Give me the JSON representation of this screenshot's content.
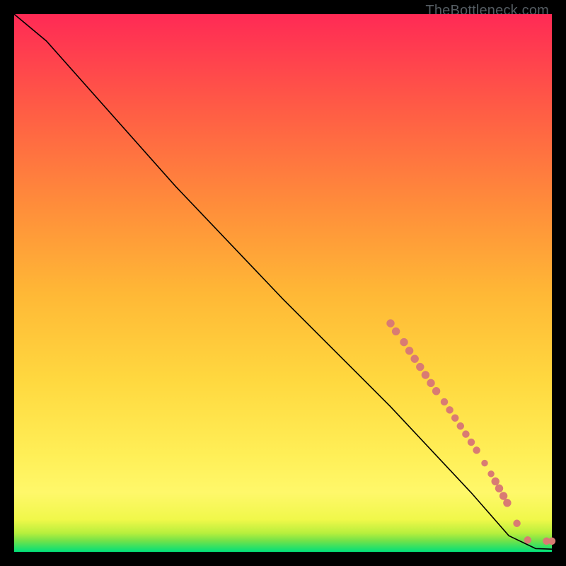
{
  "watermark": "TheBottleneck.com",
  "chart_data": {
    "type": "line",
    "title": "",
    "xlabel": "",
    "ylabel": "",
    "xlim": [
      0,
      100
    ],
    "ylim": [
      0,
      100
    ],
    "curve": {
      "name": "bottleneck-curve",
      "points": [
        {
          "x": 0,
          "y": 100
        },
        {
          "x": 6,
          "y": 95
        },
        {
          "x": 14,
          "y": 86
        },
        {
          "x": 30,
          "y": 68
        },
        {
          "x": 50,
          "y": 47
        },
        {
          "x": 70,
          "y": 27
        },
        {
          "x": 85,
          "y": 11
        },
        {
          "x": 92,
          "y": 3
        },
        {
          "x": 97,
          "y": 0.6
        },
        {
          "x": 100,
          "y": 0.5
        }
      ]
    },
    "scatter": {
      "name": "data-points",
      "color": "#d97b73",
      "points": [
        {
          "x": 70.0,
          "y": 42.5,
          "r": 5.5
        },
        {
          "x": 71.0,
          "y": 41.0,
          "r": 5.5
        },
        {
          "x": 72.5,
          "y": 39.0,
          "r": 5.5
        },
        {
          "x": 73.5,
          "y": 37.4,
          "r": 5.5
        },
        {
          "x": 74.5,
          "y": 35.9,
          "r": 5.5
        },
        {
          "x": 75.5,
          "y": 34.4,
          "r": 5.5
        },
        {
          "x": 76.5,
          "y": 32.9,
          "r": 5.5
        },
        {
          "x": 77.5,
          "y": 31.4,
          "r": 5.5
        },
        {
          "x": 78.5,
          "y": 29.9,
          "r": 5.5
        },
        {
          "x": 80.0,
          "y": 27.9,
          "r": 5.0
        },
        {
          "x": 81.0,
          "y": 26.4,
          "r": 5.0
        },
        {
          "x": 82.0,
          "y": 24.9,
          "r": 5.0
        },
        {
          "x": 83.0,
          "y": 23.4,
          "r": 5.0
        },
        {
          "x": 84.0,
          "y": 21.9,
          "r": 5.0
        },
        {
          "x": 85.0,
          "y": 20.4,
          "r": 5.0
        },
        {
          "x": 86.0,
          "y": 18.9,
          "r": 5.0
        },
        {
          "x": 87.5,
          "y": 16.5,
          "r": 4.5
        },
        {
          "x": 88.7,
          "y": 14.5,
          "r": 4.5
        },
        {
          "x": 89.5,
          "y": 13.1,
          "r": 5.5
        },
        {
          "x": 90.2,
          "y": 11.8,
          "r": 5.5
        },
        {
          "x": 91.0,
          "y": 10.4,
          "r": 5.5
        },
        {
          "x": 91.7,
          "y": 9.1,
          "r": 5.5
        },
        {
          "x": 93.5,
          "y": 5.3,
          "r": 5.0
        },
        {
          "x": 95.5,
          "y": 2.2,
          "r": 5.0
        },
        {
          "x": 99.0,
          "y": 2.0,
          "r": 5.0
        },
        {
          "x": 100.0,
          "y": 2.0,
          "r": 5.0
        }
      ]
    }
  }
}
